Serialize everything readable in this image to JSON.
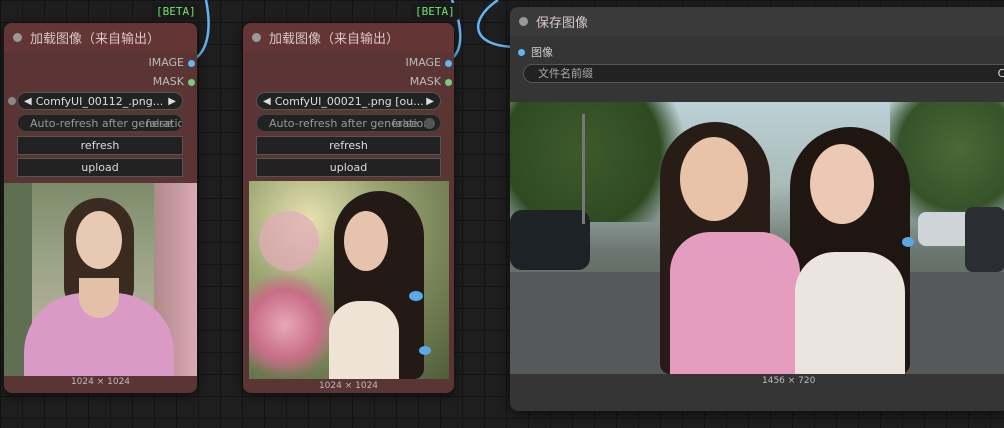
{
  "badges": [
    "[BETA]",
    "[BETA]"
  ],
  "load_nodes": [
    {
      "title": "加载图像（来自输出）",
      "outputs": [
        "IMAGE",
        "MASK"
      ],
      "image_file": "ComfyUI_00112_.png...",
      "auto_refresh": "Auto-refresh after generation",
      "auto_refresh_value": "false",
      "refresh_label": "refresh",
      "upload_label": "upload",
      "dimensions": "1024 × 1024"
    },
    {
      "title": "加载图像（来自输出）",
      "outputs": [
        "IMAGE",
        "MASK"
      ],
      "image_file": "ComfyUI_00021_.png [ou...",
      "auto_refresh": "Auto-refresh after generation",
      "auto_refresh_value": "false",
      "refresh_label": "refresh",
      "upload_label": "upload",
      "dimensions": "1024 × 1024"
    }
  ],
  "save_node": {
    "title": "保存图像",
    "input_label": "图像",
    "prefix_label": "文件名前缀",
    "prefix_value": "Co",
    "dimensions": "1456 × 720"
  },
  "colors": {
    "load_node_bg": "#5b3434",
    "save_node_bg": "#353535",
    "image_dot": "#64b5f6",
    "mask_dot": "#81c784",
    "link": "#64b5f6",
    "badge_text": "#6fe56f"
  },
  "icons": [
    "arrow-left-icon",
    "arrow-right-icon",
    "node-status-dot"
  ]
}
